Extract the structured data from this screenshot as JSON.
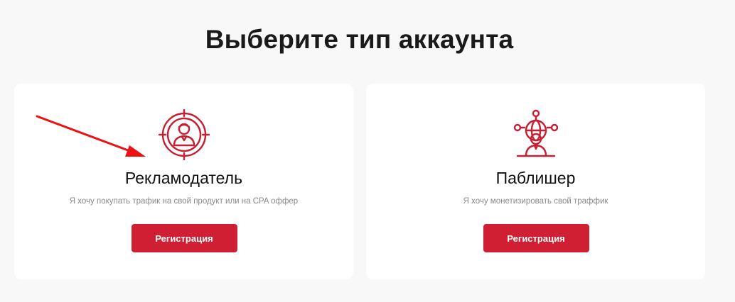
{
  "page": {
    "title": "Выберите тип аккаунта"
  },
  "cards": [
    {
      "icon": "target-person-icon",
      "title": "Рекламодатель",
      "description": "Я хочу покупать трафик на свой продукт или на CPA оффер",
      "button_label": "Регистрация"
    },
    {
      "icon": "globe-network-person-icon",
      "title": "Паблишер",
      "description": "Я хочу монетизировать свой траффик",
      "button_label": "Регистрация"
    }
  ],
  "colors": {
    "accent": "#d01f33",
    "background": "#f8f8f8",
    "card": "#ffffff",
    "annotation_arrow": "#ee1111"
  }
}
